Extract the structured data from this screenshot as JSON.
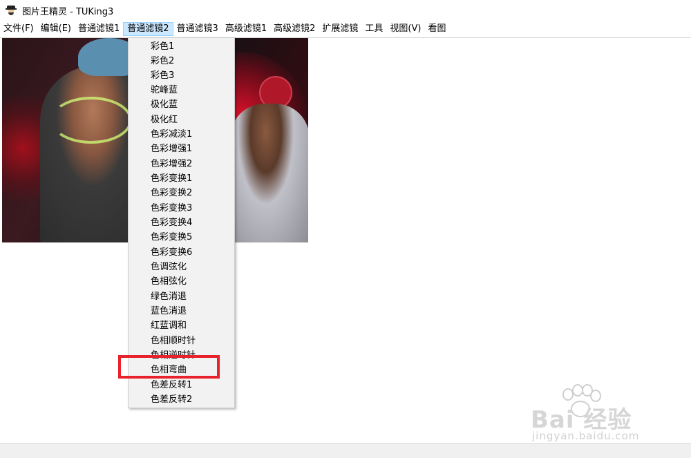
{
  "window": {
    "title": "图片王精灵 - TUKing3"
  },
  "menubar": {
    "items": [
      {
        "label": "文件(F)",
        "active": false
      },
      {
        "label": "编辑(E)",
        "active": false
      },
      {
        "label": "普通滤镜1",
        "active": false
      },
      {
        "label": "普通滤镜2",
        "active": true
      },
      {
        "label": "普通滤镜3",
        "active": false
      },
      {
        "label": "高级滤镜1",
        "active": false
      },
      {
        "label": "高级滤镜2",
        "active": false
      },
      {
        "label": "扩展滤镜",
        "active": false
      },
      {
        "label": "工具",
        "active": false
      },
      {
        "label": "视图(V)",
        "active": false
      },
      {
        "label": "看图",
        "active": false
      }
    ]
  },
  "dropdown": {
    "parent_menu": "普通滤镜2",
    "items": [
      "彩色1",
      "彩色2",
      "彩色3",
      "驼峰蓝",
      "极化蓝",
      "极化红",
      "色彩减淡1",
      "色彩增强1",
      "色彩增强2",
      "色彩变换1",
      "色彩变换2",
      "色彩变换3",
      "色彩变换4",
      "色彩变换5",
      "色彩变换6",
      "色调弦化",
      "色相弦化",
      "绿色消退",
      "蓝色消退",
      "红蓝调和",
      "色相顺时针",
      "色相逆时针",
      "色相弯曲",
      "色差反转1",
      "色差反转2"
    ],
    "highlighted_item": "色相弯曲"
  },
  "annotation": {
    "color": "#e8212a"
  },
  "watermark": {
    "brand": "Bai 经验",
    "domain": "jingyan.baidu.com"
  },
  "colors": {
    "menu_active_bg": "#cce8ff",
    "dropdown_bg": "#f2f2f2"
  }
}
